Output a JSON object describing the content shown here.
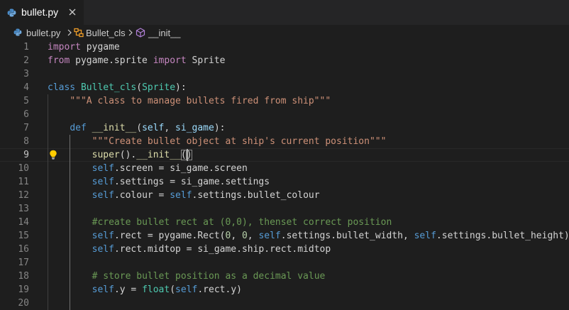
{
  "tab": {
    "label": "bullet.py",
    "close_icon": "close-icon",
    "file_icon": "python-file-icon"
  },
  "breadcrumb": {
    "file": "bullet.py",
    "class": "Bullet_cls",
    "method": "__init__"
  },
  "colors": {
    "keyword": "#c586c0",
    "storage": "#569cd6",
    "class_name": "#4ec9b0",
    "function": "#dcdcaa",
    "parameter": "#9cdcfe",
    "string": "#ce9178",
    "number": "#b5cea8",
    "comment": "#6a9955",
    "plain": "#d4d4d4",
    "line_number": "#858585",
    "background": "#1e1e1e"
  },
  "editor": {
    "active_line": 9,
    "lines": [
      {
        "n": "1",
        "tokens": [
          [
            "kw",
            "import"
          ],
          [
            "plain",
            " pygame"
          ]
        ]
      },
      {
        "n": "2",
        "tokens": [
          [
            "kw",
            "from"
          ],
          [
            "plain",
            " pygame.sprite "
          ],
          [
            "kw",
            "import"
          ],
          [
            "plain",
            " Sprite"
          ]
        ]
      },
      {
        "n": "3",
        "tokens": []
      },
      {
        "n": "4",
        "tokens": [
          [
            "def",
            "class"
          ],
          [
            "plain",
            " "
          ],
          [
            "cls",
            "Bullet_cls"
          ],
          [
            "plain",
            "("
          ],
          [
            "cls",
            "Sprite"
          ],
          [
            "plain",
            "):"
          ]
        ]
      },
      {
        "n": "5",
        "tokens": [
          [
            "plain",
            "    "
          ],
          [
            "str",
            "\"\"\"A class to manage bullets fired from ship\"\"\""
          ]
        ]
      },
      {
        "n": "6",
        "tokens": []
      },
      {
        "n": "7",
        "tokens": [
          [
            "plain",
            "    "
          ],
          [
            "def",
            "def"
          ],
          [
            "plain",
            " "
          ],
          [
            "fn",
            "__init__"
          ],
          [
            "plain",
            "("
          ],
          [
            "param",
            "self"
          ],
          [
            "plain",
            ", "
          ],
          [
            "param",
            "si_game"
          ],
          [
            "plain",
            "):"
          ]
        ]
      },
      {
        "n": "8",
        "tokens": [
          [
            "plain",
            "        "
          ],
          [
            "str",
            "\"\"\"Create bullet object at ship's current position\"\"\""
          ]
        ]
      },
      {
        "n": "9",
        "tokens": [
          [
            "plain",
            "        "
          ],
          [
            "fn",
            "super"
          ],
          [
            "plain",
            "()."
          ],
          [
            "fn",
            "__init__"
          ],
          [
            "plain",
            "()"
          ]
        ]
      },
      {
        "n": "10",
        "tokens": [
          [
            "plain",
            "        "
          ],
          [
            "self",
            "self"
          ],
          [
            "plain",
            ".screen = si_game.screen"
          ]
        ]
      },
      {
        "n": "11",
        "tokens": [
          [
            "plain",
            "        "
          ],
          [
            "self",
            "self"
          ],
          [
            "plain",
            ".settings = si_game.settings"
          ]
        ]
      },
      {
        "n": "12",
        "tokens": [
          [
            "plain",
            "        "
          ],
          [
            "self",
            "self"
          ],
          [
            "plain",
            ".colour = "
          ],
          [
            "self",
            "self"
          ],
          [
            "plain",
            ".settings.bullet_colour"
          ]
        ]
      },
      {
        "n": "13",
        "tokens": []
      },
      {
        "n": "14",
        "tokens": [
          [
            "plain",
            "        "
          ],
          [
            "com",
            "#create bullet rect at (0,0), thenset correct position"
          ]
        ]
      },
      {
        "n": "15",
        "tokens": [
          [
            "plain",
            "        "
          ],
          [
            "self",
            "self"
          ],
          [
            "plain",
            ".rect = pygame.Rect("
          ],
          [
            "num",
            "0"
          ],
          [
            "plain",
            ", "
          ],
          [
            "num",
            "0"
          ],
          [
            "plain",
            ", "
          ],
          [
            "self",
            "self"
          ],
          [
            "plain",
            ".settings.bullet_width, "
          ],
          [
            "self",
            "self"
          ],
          [
            "plain",
            ".settings.bullet_height)"
          ]
        ]
      },
      {
        "n": "16",
        "tokens": [
          [
            "plain",
            "        "
          ],
          [
            "self",
            "self"
          ],
          [
            "plain",
            ".rect.midtop = si_game.ship.rect.midtop"
          ]
        ]
      },
      {
        "n": "17",
        "tokens": []
      },
      {
        "n": "18",
        "tokens": [
          [
            "plain",
            "        "
          ],
          [
            "com",
            "# store bullet position as a decimal value"
          ]
        ]
      },
      {
        "n": "19",
        "tokens": [
          [
            "plain",
            "        "
          ],
          [
            "self",
            "self"
          ],
          [
            "plain",
            ".y = "
          ],
          [
            "cls",
            "float"
          ],
          [
            "plain",
            "("
          ],
          [
            "self",
            "self"
          ],
          [
            "plain",
            ".rect.y)"
          ]
        ]
      },
      {
        "n": "20",
        "tokens": []
      }
    ]
  }
}
